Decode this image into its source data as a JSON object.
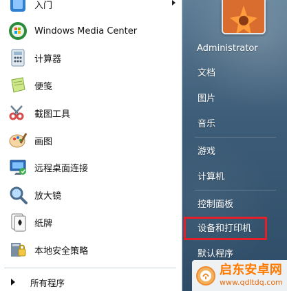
{
  "left_pane": {
    "items": [
      {
        "label": "入门",
        "icon": "getting-started-icon",
        "has_submenu": true
      },
      {
        "label": "Windows Media Center",
        "icon": "windows-media-center-icon",
        "has_submenu": false
      },
      {
        "label": "计算器",
        "icon": "calculator-icon",
        "has_submenu": false
      },
      {
        "label": "便笺",
        "icon": "sticky-notes-icon",
        "has_submenu": false
      },
      {
        "label": "截图工具",
        "icon": "snipping-tool-icon",
        "has_submenu": false
      },
      {
        "label": "画图",
        "icon": "paint-icon",
        "has_submenu": false
      },
      {
        "label": "远程桌面连接",
        "icon": "remote-desktop-icon",
        "has_submenu": false
      },
      {
        "label": "放大镜",
        "icon": "magnifier-icon",
        "has_submenu": false
      },
      {
        "label": "纸牌",
        "icon": "solitaire-icon",
        "has_submenu": false
      },
      {
        "label": "本地安全策略",
        "icon": "local-security-policy-icon",
        "has_submenu": false
      }
    ],
    "all_programs": "所有程序"
  },
  "right_pane": {
    "user_name": "Administrator",
    "links": [
      "文档",
      "图片",
      "音乐",
      "游戏",
      "计算机",
      "控制面板",
      "设备和打印机",
      "默认程序"
    ]
  },
  "watermark": {
    "title": "启东安卓网",
    "url": "www.qdltdq.com"
  }
}
